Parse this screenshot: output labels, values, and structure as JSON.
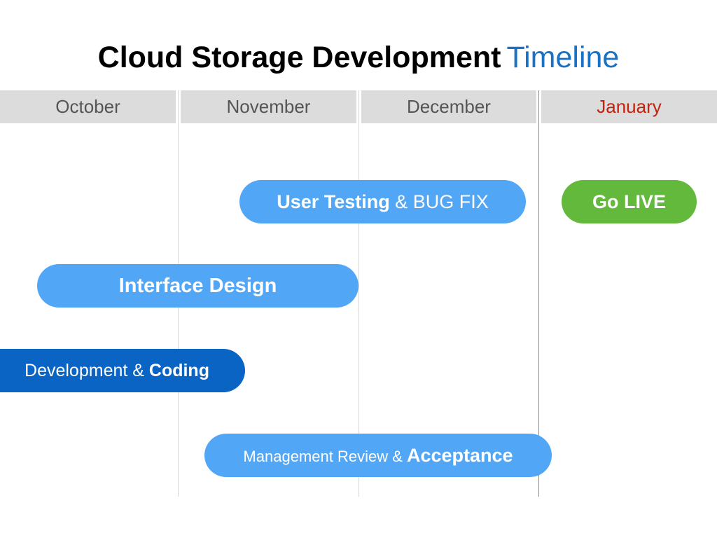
{
  "title": {
    "main": "Cloud Storage Development",
    "accent": "Timeline"
  },
  "months": [
    "October",
    "November",
    "December",
    "January"
  ],
  "current_month_index": 3,
  "tasks": [
    {
      "bold_first": "User Testing",
      "rest": " & BUG FIX"
    },
    {
      "bold_first": "Go LIVE"
    },
    {
      "bold_first": "Interface Design"
    },
    {
      "plain_first": "Development & ",
      "bold_last": "Coding"
    },
    {
      "plain_first": "Management Review & ",
      "bold_last": "Acceptance"
    }
  ],
  "colors": {
    "title_accent": "#1a72c4",
    "month_header_bg": "#dcdcdc",
    "month_text": "#555555",
    "current_month_text": "#c2220e",
    "today_marker": "#e06b5e",
    "bar_light_blue": "#52a6f6",
    "bar_dark_blue": "#0a64c4",
    "bar_green": "#62b93c"
  }
}
